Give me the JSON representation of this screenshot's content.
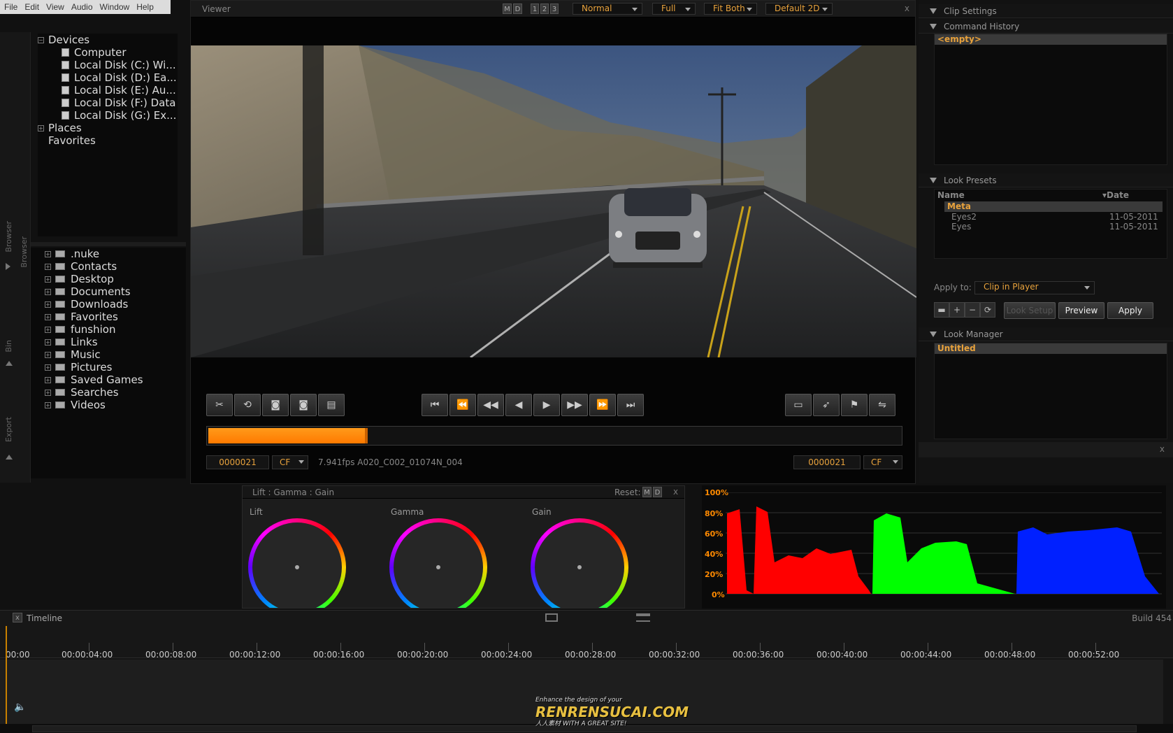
{
  "menu": [
    "File",
    "Edit",
    "View",
    "Audio",
    "Window",
    "Help"
  ],
  "side_tabs": {
    "browser": "Browser",
    "bin": "Bin",
    "export": "Export"
  },
  "devices_tree": {
    "root": "Devices",
    "items": [
      "Computer",
      "Local Disk (C:) Wi...",
      "Local Disk (D:) Ea...",
      "Local Disk (E:) Au...",
      "Local Disk (F:) Data",
      "Local Disk (G:) Ex..."
    ],
    "places": "Places",
    "favorites": "Favorites"
  },
  "folders_tree": [
    ".nuke",
    "Contacts",
    "Desktop",
    "Documents",
    "Downloads",
    "Favorites",
    "funshion",
    "Links",
    "Music",
    "Pictures",
    "Saved Games",
    "Searches",
    "Videos"
  ],
  "viewer": {
    "title": "Viewer",
    "mode_m": "M",
    "mode_d": "D",
    "num_1": "1",
    "num_2": "2",
    "num_3": "3",
    "blend": "Normal",
    "resolution": "Full",
    "fit": "Fit Both",
    "lut": "Default 2D",
    "close": "x"
  },
  "transport": {
    "progress_fraction": 0.23,
    "in_timecode": "0000021",
    "out_timecode": "0000021",
    "in_cf": "CF",
    "out_cf": "CF",
    "clip_info": "7.941fps A020_C002_01074N_004"
  },
  "right": {
    "clip_settings": "Clip Settings",
    "command_history": "Command History",
    "history_item": "<empty>",
    "look_presets": "Look Presets",
    "col_name": "Name",
    "col_date": "Date",
    "presets": [
      {
        "name": "Meta",
        "date": ""
      },
      {
        "name": "Eyes2",
        "date": "11-05-2011"
      },
      {
        "name": "Eyes",
        "date": "11-05-2011"
      }
    ],
    "apply_to_label": "Apply to:",
    "apply_to_value": "Clip in Player",
    "look_setup": "Look Setup",
    "preview": "Preview",
    "apply": "Apply",
    "look_manager": "Look Manager",
    "look_item": "Untitled",
    "close": "x"
  },
  "wheels": {
    "title": "Lift : Gamma : Gain",
    "reset": "Reset:",
    "reset_m": "M",
    "reset_d": "D",
    "close": "x",
    "lift": "Lift",
    "gamma": "Gamma",
    "gain": "Gain"
  },
  "histogram": {
    "labels": [
      "100%",
      "80%",
      "60%",
      "40%",
      "20%",
      "0%"
    ],
    "colors": {
      "red": "#ff0000",
      "green": "#00ff00",
      "blue": "#0020ff"
    }
  },
  "timeline": {
    "title": "Timeline",
    "close": "x",
    "build": "Build 454",
    "ticks": [
      "00:00",
      "00:00:04:00",
      "00:00:08:00",
      "00:00:12:00",
      "00:00:16:00",
      "00:00:20:00",
      "00:00:24:00",
      "00:00:28:00",
      "00:00:32:00",
      "00:00:36:00",
      "00:00:40:00",
      "00:00:44:00",
      "00:00:48:00",
      "00:00:52:00"
    ]
  },
  "watermark": {
    "main": "RENRENSUCAI.COM",
    "tagline": "Enhance the design of your",
    "sub": "人人素材 WITH A GREAT SITE!"
  },
  "accent": "#e8a23c"
}
